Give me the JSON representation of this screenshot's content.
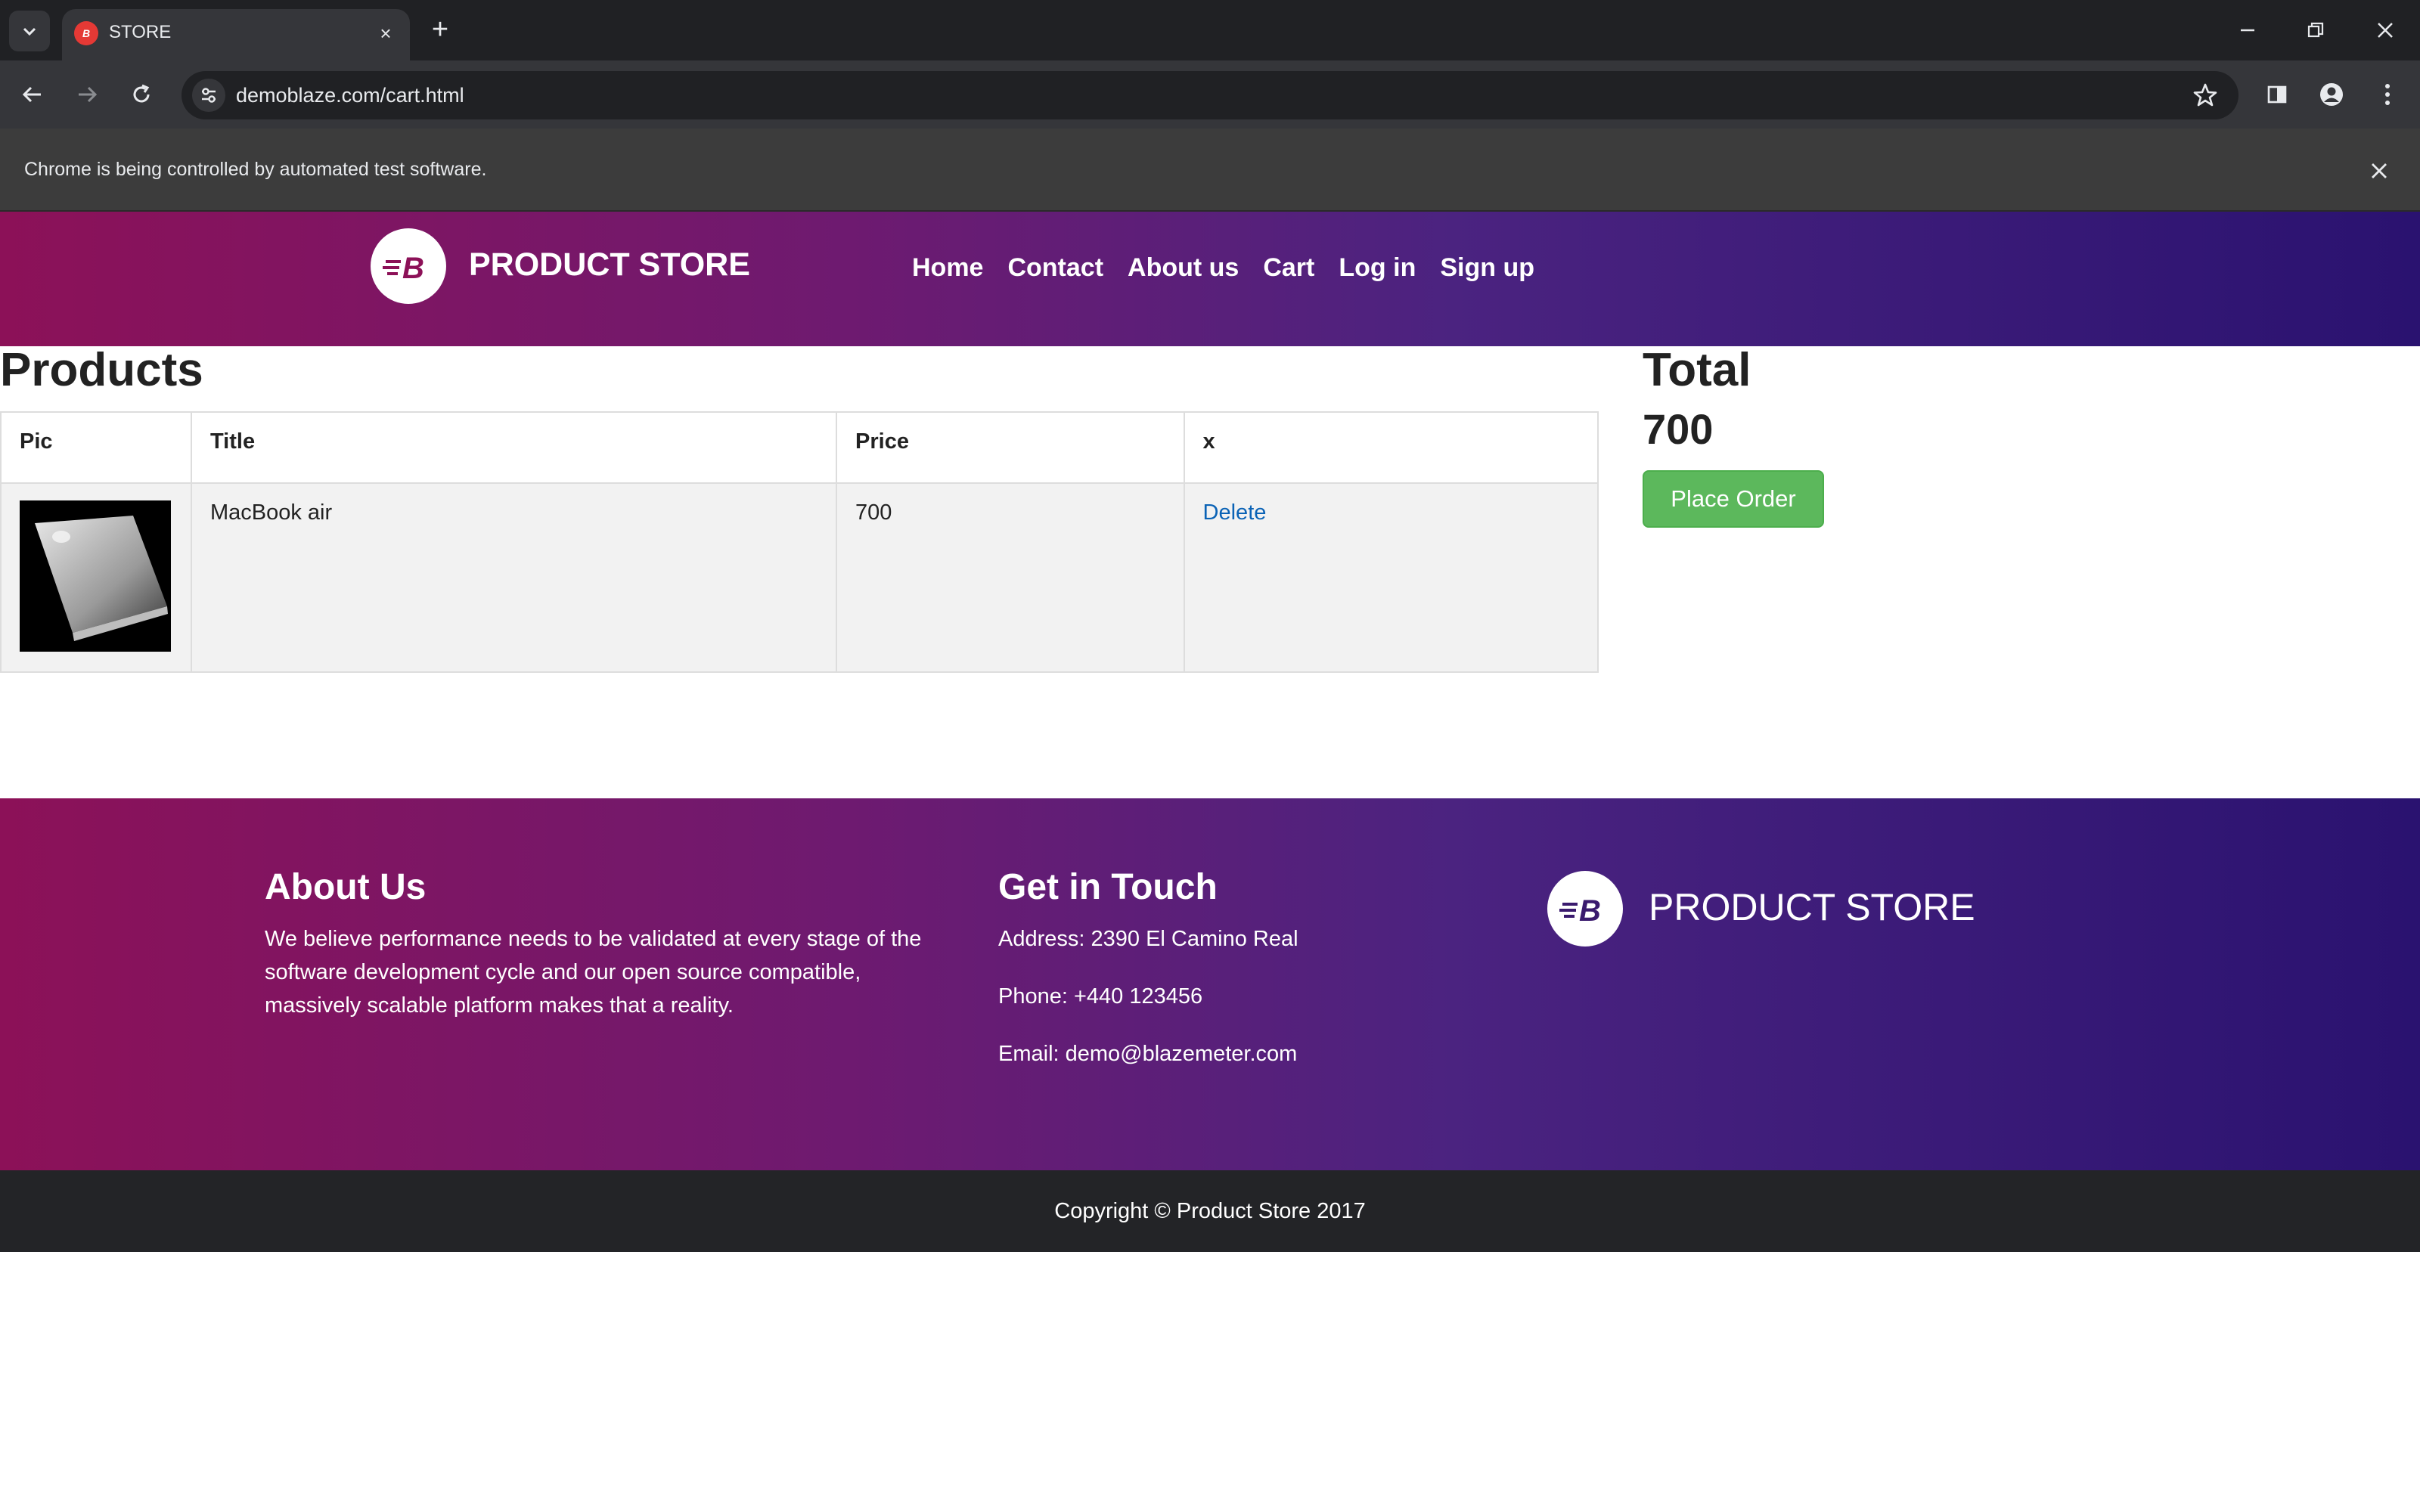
{
  "browser": {
    "tab_title": "STORE",
    "url": "demoblaze.com/cart.html",
    "infobar_text": "Chrome is being controlled by automated test software."
  },
  "nav": {
    "brand": "PRODUCT STORE",
    "links": [
      "Home",
      "Contact",
      "About us",
      "Cart",
      "Log in",
      "Sign up"
    ]
  },
  "cart": {
    "heading": "Products",
    "columns": [
      "Pic",
      "Title",
      "Price",
      "x"
    ],
    "rows": [
      {
        "title": "MacBook air",
        "price": "700",
        "action": "Delete"
      }
    ]
  },
  "summary": {
    "heading": "Total",
    "total": "700",
    "place_order_label": "Place Order"
  },
  "footer": {
    "about_heading": "About Us",
    "about_text": "We believe performance needs to be validated at every stage of the software development cycle and our open source compatible, massively scalable platform makes that a reality.",
    "contact_heading": "Get in Touch",
    "address": "Address: 2390 El Camino Real",
    "phone": "Phone: +440 123456",
    "email": "Email: demo@blazemeter.com",
    "brand": "PRODUCT STORE",
    "copyright": "Copyright © Product Store 2017"
  },
  "colors": {
    "gradient_start": "#8c1158",
    "gradient_end": "#2a1270",
    "place_order": "#5cb85c",
    "link": "#0b63b6"
  },
  "icons": [
    "tab-search-icon",
    "close-icon",
    "plus-icon",
    "minimize-icon",
    "restore-icon",
    "back-icon",
    "forward-icon",
    "reload-icon",
    "site-settings-icon",
    "star-icon",
    "side-panel-icon",
    "profile-icon",
    "more-icon",
    "blazemeter-logo-icon"
  ]
}
